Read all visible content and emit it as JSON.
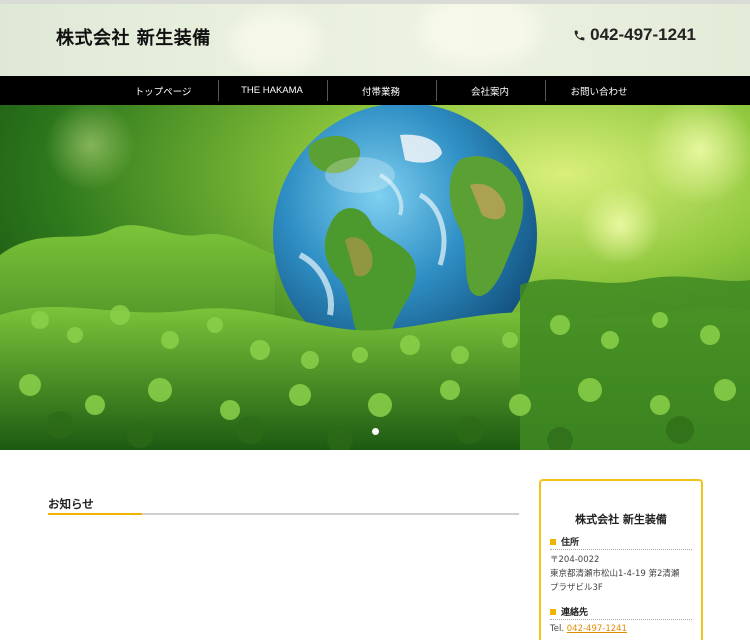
{
  "header": {
    "company_name": "株式会社 新生装備",
    "phone": "042-497-1241",
    "phone_icon": "phone-icon"
  },
  "nav": {
    "items": [
      {
        "label": "トップページ"
      },
      {
        "label": "THE HAKAMA"
      },
      {
        "label": "付帯業務"
      },
      {
        "label": "会社案内"
      },
      {
        "label": "お問い合わせ"
      }
    ]
  },
  "hero": {
    "image": "globe-on-moss-image",
    "slides_count": 1,
    "active_slide": 1
  },
  "main": {
    "news_heading": "お知らせ"
  },
  "sidebar": {
    "company_name": "株式会社 新生装備",
    "address_label": "住所",
    "postal": "〒204-0022",
    "address_line1": "東京都清瀬市松山1-4-19 第2清瀬",
    "address_line2": "プラザビル3F",
    "contact_label": "連絡先",
    "tel_prefix": "Tel.",
    "tel_value": "042-497-1241"
  },
  "colors": {
    "accent": "#f0b400",
    "nav_bg": "#000000",
    "link": "#e08a00"
  }
}
